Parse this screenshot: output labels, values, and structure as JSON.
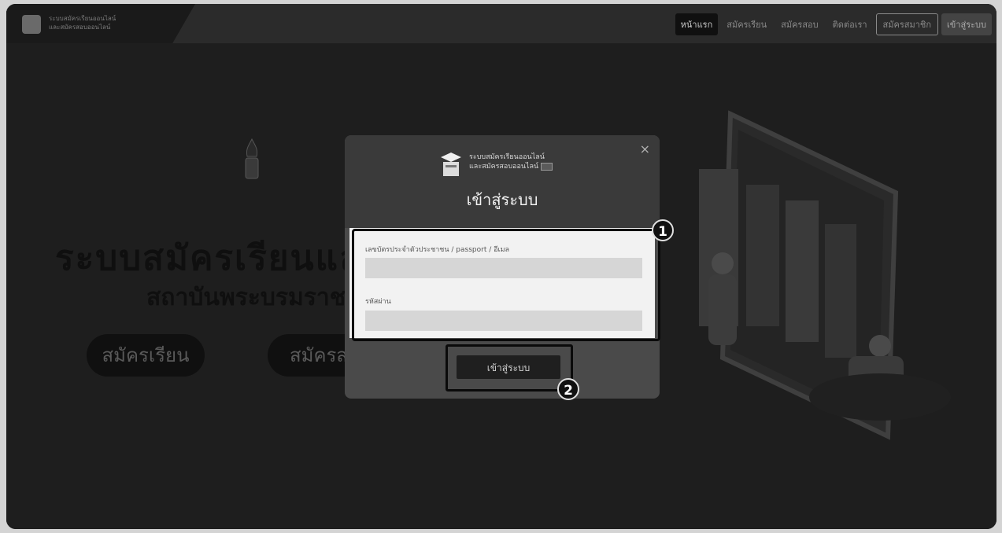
{
  "header": {
    "logo_text_line1": "ระบบสมัครเรียนออนไลน์",
    "logo_text_line2": "และสมัครสอบออนไลน์",
    "nav": [
      {
        "label": "หน้าแรก"
      },
      {
        "label": "สมัครเรียน"
      },
      {
        "label": "สมัครสอบ"
      },
      {
        "label": "ติดต่อเรา"
      },
      {
        "label": "สมัครสมาชิก"
      },
      {
        "label": "เข้าสู่ระบบ"
      }
    ]
  },
  "hero": {
    "title": "ระบบสมัครเรียนและ",
    "subtitle": "สถาบันพระบรมราชชนก",
    "buttons": [
      {
        "label": "สมัครเรียน"
      },
      {
        "label": "สมัครส"
      }
    ]
  },
  "modal": {
    "close": "×",
    "brand_line1": "ระบบสมัครเรียนออนไลน์",
    "brand_line2": "และสมัครสอบออนไลน์",
    "title": "เข้าสู่ระบบ",
    "username_label": "เลขบัตรประจำตัวประชาชน / passport / อีเมล",
    "password_label": "รหัสผ่าน",
    "submit_label": "เข้าสู่ระบบ"
  },
  "annotations": {
    "marker1": "1",
    "marker2": "2"
  }
}
